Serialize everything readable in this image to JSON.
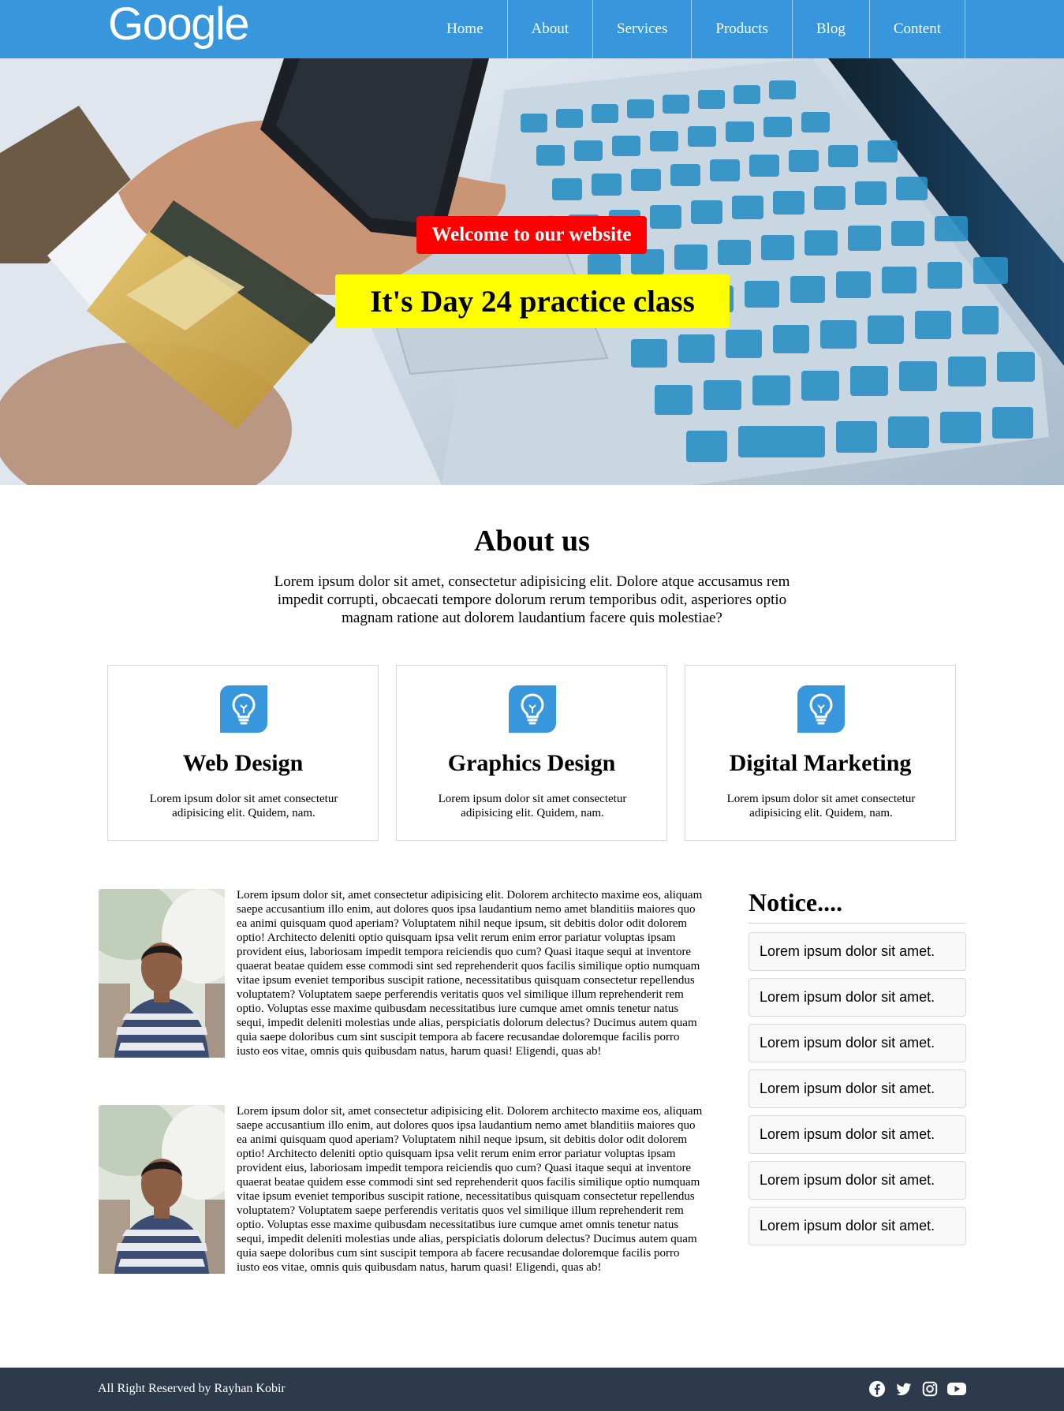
{
  "header": {
    "logo": "Google",
    "nav": [
      "Home",
      "About",
      "Services",
      "Products",
      "Blog",
      "Content"
    ]
  },
  "hero": {
    "welcome": "Welcome to our website",
    "title": "It's Day 24 practice class"
  },
  "about": {
    "title": "About us",
    "text": "Lorem ipsum dolor sit amet, consectetur adipisicing elit. Dolore atque accusamus rem impedit corrupti, obcaecati tempore dolorum rerum temporibus odit, asperiores optio magnam ratione aut dolorem laudantium facere quis molestiae?"
  },
  "services": [
    {
      "title": "Web Design",
      "text": "Lorem ipsum dolor sit amet consectetur adipisicing elit. Quidem, nam.",
      "icon": "lightbulb-icon"
    },
    {
      "title": "Graphics Design",
      "text": "Lorem ipsum dolor sit amet consectetur adipisicing elit. Quidem, nam.",
      "icon": "lightbulb-icon"
    },
    {
      "title": "Digital Marketing",
      "text": "Lorem ipsum dolor sit amet consectetur adipisicing elit. Quidem, nam.",
      "icon": "lightbulb-icon"
    }
  ],
  "posts": [
    {
      "text": "Lorem ipsum dolor sit, amet consectetur adipisicing elit. Dolorem architecto maxime eos, aliquam saepe accusantium illo enim, aut dolores quos ipsa laudantium nemo amet blanditiis maiores quo ea animi quisquam quod aperiam? Voluptatem nihil neque ipsum, sit debitis dolor odit dolorem optio! Architecto deleniti optio quisquam ipsa velit rerum enim error pariatur voluptas ipsam provident eius, laboriosam impedit tempora reiciendis quo cum? Quasi itaque sequi at inventore quaerat beatae quidem esse commodi sint sed reprehenderit quos facilis similique optio numquam vitae ipsum eveniet temporibus suscipit ratione, necessitatibus quisquam consectetur repellendus voluptatem? Voluptatem saepe perferendis veritatis quos vel similique illum reprehenderit rem optio. Voluptas esse maxime quibusdam necessitatibus iure cumque amet omnis tenetur natus sequi, impedit deleniti molestias unde alias, perspiciatis dolorum delectus? Ducimus autem quam quia saepe doloribus cum sint suscipit tempora ab facere recusandae doloremque facilis porro iusto eos vitae, omnis quis quibusdam natus, harum quasi! Eligendi, quas ab!"
    },
    {
      "text": "Lorem ipsum dolor sit, amet consectetur adipisicing elit. Dolorem architecto maxime eos, aliquam saepe accusantium illo enim, aut dolores quos ipsa laudantium nemo amet blanditiis maiores quo ea animi quisquam quod aperiam? Voluptatem nihil neque ipsum, sit debitis dolor odit dolorem optio! Architecto deleniti optio quisquam ipsa velit rerum enim error pariatur voluptas ipsam provident eius, laboriosam impedit tempora reiciendis quo cum? Quasi itaque sequi at inventore quaerat beatae quidem esse commodi sint sed reprehenderit quos facilis similique optio numquam vitae ipsum eveniet temporibus suscipit ratione, necessitatibus quisquam consectetur repellendus voluptatem? Voluptatem saepe perferendis veritatis quos vel similique illum reprehenderit rem optio. Voluptas esse maxime quibusdam necessitatibus iure cumque amet omnis tenetur natus sequi, impedit deleniti molestias unde alias, perspiciatis dolorum delectus? Ducimus autem quam quia saepe doloribus cum sint suscipit tempora ab facere recusandae doloremque facilis porro iusto eos vitae, omnis quis quibusdam natus, harum quasi! Eligendi, quas ab!"
    }
  ],
  "notice": {
    "title": "Notice....",
    "items": [
      "Lorem ipsum dolor sit amet.",
      "Lorem ipsum dolor sit amet.",
      "Lorem ipsum dolor sit amet.",
      "Lorem ipsum dolor sit amet.",
      "Lorem ipsum dolor sit amet.",
      "Lorem ipsum dolor sit amet.",
      "Lorem ipsum dolor sit amet."
    ]
  },
  "footer": {
    "text": "All Right Reserved by Rayhan Kobir",
    "social": [
      "facebook-icon",
      "twitter-icon",
      "instagram-icon",
      "youtube-icon"
    ]
  },
  "colors": {
    "primary": "#3796dc",
    "welcome_bg": "#fe0000",
    "title_bg": "#ffff00",
    "footer_bg": "#2c3a4b"
  }
}
